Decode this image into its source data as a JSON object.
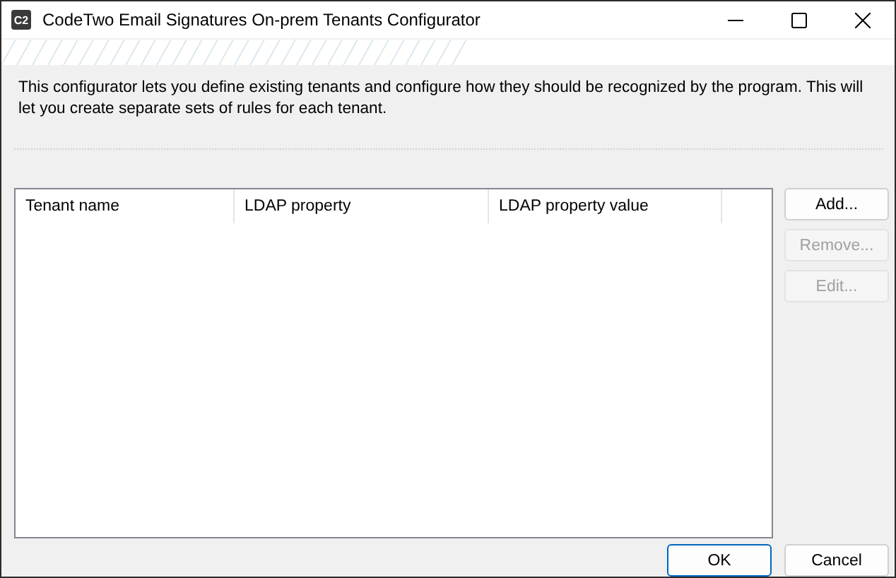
{
  "window": {
    "logo": "C2",
    "title": "CodeTwo Email Signatures On-prem Tenants Configurator"
  },
  "description": "This configurator lets you define existing tenants and configure how they should be recognized by the program. This will let you create separate sets of rules for each tenant.",
  "table": {
    "columns": [
      "Tenant name",
      "LDAP property",
      "LDAP property value"
    ]
  },
  "side_buttons": [
    {
      "label": "Add...",
      "disabled": false
    },
    {
      "label": "Remove...",
      "disabled": true
    },
    {
      "label": "Edit...",
      "disabled": true
    }
  ],
  "footer_buttons": [
    {
      "label": "OK",
      "default": true
    },
    {
      "label": "Cancel",
      "default": false
    }
  ]
}
